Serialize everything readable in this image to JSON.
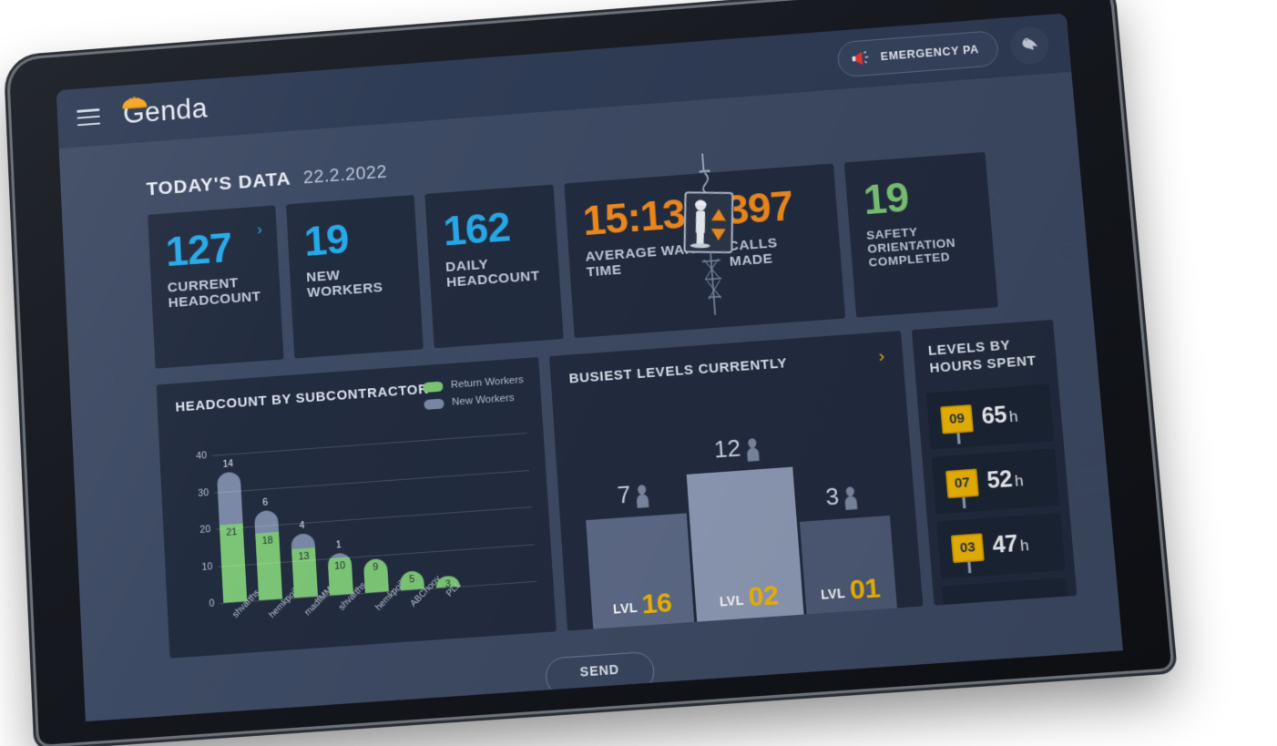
{
  "header": {
    "menu_icon": "hamburger-icon",
    "logo_text": "enda",
    "logo_mark": "hard-hat-icon",
    "emergency_button": "EMERGENCY PA",
    "emergency_icon": "megaphone-icon",
    "dove_icon": "dove-icon"
  },
  "section": {
    "title": "TODAY'S DATA",
    "date": "22.2.2022"
  },
  "kpis": [
    {
      "value": "127",
      "label": "CURRENT HEADCOUNT",
      "color": "#26a9e8",
      "chevron": "›"
    },
    {
      "value": "19",
      "label": "NEW WORKERS",
      "color": "#26a9e8"
    },
    {
      "value": "162",
      "label": "DAILY HEADCOUNT",
      "color": "#26a9e8"
    },
    {
      "value": "15:13",
      "label": "AVERAGE WAIT TIME",
      "color": "#f18a1d"
    },
    {
      "value": "397",
      "label": "CALLS MADE",
      "color": "#f18a1d"
    },
    {
      "value": "19",
      "label": "SAFETY ORIENTATION COMPLETED",
      "color": "#7cc576"
    }
  ],
  "subcontractor_panel": {
    "title": "HEADCOUNT BY SUBCONTRACTOR",
    "legend": [
      {
        "label": "Return Workers",
        "color": "#7cc576"
      },
      {
        "label": "New Workers",
        "color": "#7b88a6"
      }
    ]
  },
  "busiest_panel": {
    "title": "BUSIEST LEVELS CURRENTLY",
    "chevron": "›",
    "podium": [
      {
        "level": "LVL",
        "number": "16",
        "count": "7",
        "worker_icon": "worker-silhouette-icon"
      },
      {
        "level": "LVL",
        "number": "02",
        "count": "12",
        "worker_icon": "worker-silhouette-icon"
      },
      {
        "level": "LVL",
        "number": "01",
        "count": "3",
        "worker_icon": "worker-silhouette-icon"
      }
    ]
  },
  "levels_panel": {
    "title_line1": "LEVELS BY",
    "title_line2": "HOURS SPENT",
    "rows": [
      {
        "level": "09",
        "hours": "65",
        "unit": "h"
      },
      {
        "level": "07",
        "hours": "52",
        "unit": "h"
      },
      {
        "level": "03",
        "hours": "47",
        "unit": "h"
      }
    ]
  },
  "footer": {
    "send_label": "SEND"
  },
  "chart_data": {
    "type": "bar",
    "title": "HEADCOUNT BY SUBCONTRACTOR",
    "xlabel": "",
    "ylabel": "",
    "ylim": [
      0,
      40
    ],
    "yticks": [
      0,
      10,
      20,
      30,
      40
    ],
    "grid": true,
    "legend_position": "top-right",
    "stacked": true,
    "categories": [
      "shvarths",
      "hemkpoilik",
      "madfMMM",
      "shvarths",
      "hemkpoilik",
      "ABChooy",
      "PLL"
    ],
    "series": [
      {
        "name": "Return Workers",
        "color": "#7cc576",
        "values": [
          21,
          18,
          13,
          10,
          9,
          5,
          3
        ]
      },
      {
        "name": "New Workers",
        "color": "#7b88a6",
        "values": [
          14,
          6,
          4,
          1,
          0,
          0,
          0
        ]
      }
    ]
  }
}
